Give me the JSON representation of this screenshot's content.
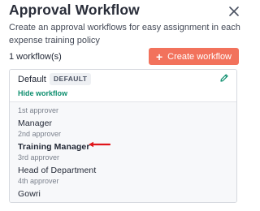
{
  "header": {
    "title": "Approval Workflow",
    "description": "Create an approval workflows for easy assignment in each expense training policy"
  },
  "toolbar": {
    "workflow_count": "1 workflow(s)",
    "create_label": "Create workflow",
    "create_icon": "plus-icon"
  },
  "workflow": {
    "name": "Default",
    "badge": "DEFAULT",
    "hide_link": "Hide workflow",
    "edit_icon": "pencil-icon",
    "approvers": [
      {
        "label": "1st approver",
        "value": "Manager"
      },
      {
        "label": "2nd approver",
        "value": "Training Manager"
      },
      {
        "label": "3rd approver",
        "value": "Head of Department"
      },
      {
        "label": "4th approver",
        "value": "Gowri"
      }
    ]
  },
  "colors": {
    "accent": "#f2725c",
    "link": "#0f8f6f",
    "annotation_arrow": "#e0151a",
    "edit_icon": "#0f8f6f"
  }
}
